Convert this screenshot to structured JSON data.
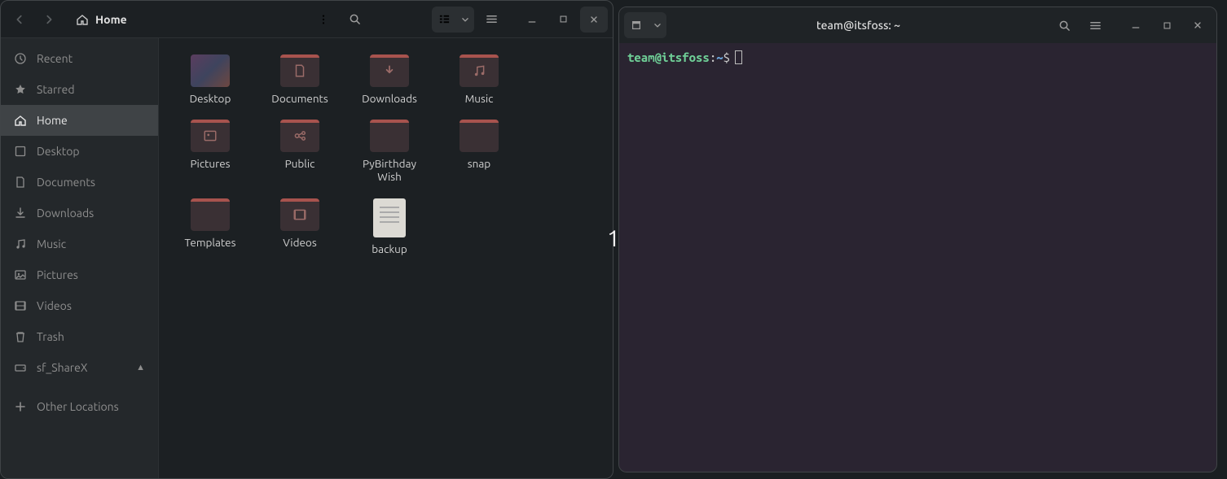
{
  "workspace_number": "1",
  "filemanager": {
    "breadcrumb": {
      "label": "Home"
    },
    "sidebar": [
      {
        "id": "recent",
        "icon": "clock",
        "label": "Recent"
      },
      {
        "id": "starred",
        "icon": "star",
        "label": "Starred"
      },
      {
        "id": "home",
        "icon": "home",
        "label": "Home",
        "active": true
      },
      {
        "id": "desktop",
        "icon": "square",
        "label": "Desktop"
      },
      {
        "id": "documents",
        "icon": "doc",
        "label": "Documents"
      },
      {
        "id": "downloads",
        "icon": "download",
        "label": "Downloads"
      },
      {
        "id": "music",
        "icon": "music",
        "label": "Music"
      },
      {
        "id": "pictures",
        "icon": "image",
        "label": "Pictures"
      },
      {
        "id": "videos",
        "icon": "video",
        "label": "Videos"
      },
      {
        "id": "trash",
        "icon": "trash",
        "label": "Trash"
      },
      {
        "id": "sfsharex",
        "icon": "drive",
        "label": "sf_ShareX",
        "eject": true
      },
      {
        "id": "other",
        "icon": "plus",
        "label": "Other Locations"
      }
    ],
    "files": [
      {
        "name": "Desktop",
        "icon": "desktop"
      },
      {
        "name": "Documents",
        "icon": "folder-doc"
      },
      {
        "name": "Downloads",
        "icon": "folder-dl"
      },
      {
        "name": "Music",
        "icon": "folder-music"
      },
      {
        "name": "Pictures",
        "icon": "folder-img"
      },
      {
        "name": "Public",
        "icon": "folder-share"
      },
      {
        "name": "PyBirthday\nWish",
        "icon": "folder"
      },
      {
        "name": "snap",
        "icon": "folder"
      },
      {
        "name": "Templates",
        "icon": "folder"
      },
      {
        "name": "Videos",
        "icon": "folder-vid"
      },
      {
        "name": "backup",
        "icon": "file"
      }
    ]
  },
  "terminal": {
    "title": "team@itsfoss: ~",
    "prompt": {
      "userhost": "team@itsfoss",
      "path": "~",
      "symbol": "$"
    }
  }
}
